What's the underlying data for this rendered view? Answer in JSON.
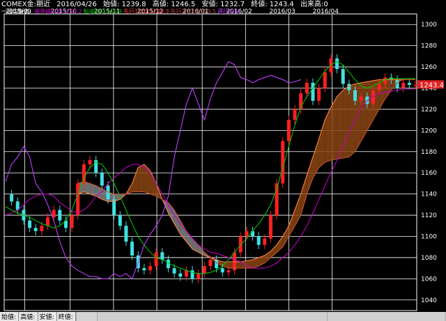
{
  "header": {
    "symbol": "COMEX金:期近",
    "date": "2016/04/26",
    "open": "始値: 1239.8",
    "high": "高値: 1246.5",
    "low": "安値: 1232.7",
    "close": "終値: 1243.4",
    "volume": "出来高:0"
  },
  "indicator_legend": {
    "title": "一目均衡表:",
    "items": [
      {
        "label": "基準線[26]1239.2",
        "color": "#c000c0"
      },
      {
        "label": "転換[9]1248.9",
        "color": "#00c000"
      },
      {
        "label": "先行1[26]1248.3",
        "color": "#ff4040"
      },
      {
        "label": "先行2[52]1173.5",
        "color": "#c04040"
      },
      {
        "label": "遅行[26]",
        "color": "#c040ff"
      }
    ]
  },
  "price_tag": "1243.4",
  "footer": {
    "labels": [
      "始値:",
      "高値:",
      "安値:",
      "終値:"
    ]
  },
  "colors": {
    "grid": "#ffffff",
    "up_candle": "#ff2020",
    "down_candle": "#40e0e0",
    "cloud": "#8b4513",
    "cloud_bear": "#808080",
    "kijun": "#c000c0",
    "tenkan": "#00c000",
    "senkou1": "#ff8040",
    "senkou2": "#c05030",
    "chikou": "#c040ff"
  },
  "chart_data": {
    "type": "line",
    "title": "COMEX金:期近",
    "x_tick_labels": [
      "2015/09",
      "2015/10",
      "2015/11",
      "2015/12",
      "2016/01",
      "2016/02",
      "2016/03",
      "2016/04"
    ],
    "y_tick_labels": [
      1040,
      1060,
      1080,
      1100,
      1120,
      1140,
      1160,
      1180,
      1200,
      1220,
      1240,
      1260,
      1280,
      1300
    ],
    "ylim": [
      1030,
      1310
    ],
    "grid": true,
    "last_price": 1243.4,
    "series": [
      {
        "name": "基準線[26]",
        "key": "kijun",
        "values": [
          1120,
          1122,
          1125,
          1130,
          1135,
          1138,
          1140,
          1140,
          1138,
          1132,
          1128,
          1124,
          1122,
          1125,
          1130,
          1138,
          1142,
          1150,
          1155,
          1160,
          1165,
          1168,
          1168,
          1165,
          1160,
          1150,
          1140,
          1130,
          1120,
          1112,
          1105,
          1098,
          1092,
          1088,
          1085,
          1084,
          1082,
          1080,
          1078,
          1076,
          1072,
          1070,
          1070,
          1070,
          1072,
          1075,
          1080,
          1085,
          1092,
          1100,
          1110,
          1122,
          1135,
          1148,
          1160,
          1172,
          1185,
          1198,
          1210,
          1222,
          1228,
          1232,
          1235,
          1236,
          1237,
          1238,
          1239,
          1239,
          1239
        ]
      },
      {
        "name": "転換[9]",
        "key": "tenkan",
        "values": [
          1128,
          1125,
          1122,
          1120,
          1118,
          1115,
          1112,
          1110,
          1108,
          1110,
          1115,
          1125,
          1140,
          1155,
          1165,
          1170,
          1168,
          1160,
          1150,
          1138,
          1125,
          1112,
          1100,
          1092,
          1085,
          1080,
          1078,
          1075,
          1072,
          1070,
          1068,
          1066,
          1065,
          1065,
          1066,
          1068,
          1072,
          1078,
          1085,
          1092,
          1098,
          1105,
          1112,
          1120,
          1130,
          1145,
          1165,
          1185,
          1205,
          1222,
          1232,
          1240,
          1248,
          1256,
          1262,
          1265,
          1262,
          1255,
          1248,
          1242,
          1240,
          1242,
          1245,
          1248,
          1249,
          1249,
          1249,
          1249,
          1249
        ]
      },
      {
        "name": "先行1[26]",
        "key": "senkou1",
        "values": [
          null,
          null,
          null,
          null,
          null,
          null,
          null,
          null,
          null,
          null,
          null,
          null,
          1140,
          1142,
          1140,
          1138,
          1135,
          1133,
          1133,
          1135,
          1140,
          1150,
          1165,
          1168,
          1162,
          1150,
          1135,
          1122,
          1112,
          1102,
          1095,
          1088,
          1085,
          1082,
          1080,
          1078,
          1076,
          1076,
          1076,
          1076,
          1077,
          1078,
          1080,
          1082,
          1086,
          1092,
          1100,
          1110,
          1125,
          1140,
          1158,
          1175,
          1192,
          1210,
          1222,
          1232,
          1238,
          1242,
          1244,
          1245,
          1246,
          1247,
          1248,
          1248,
          1248,
          1248,
          1248,
          1248,
          1248
        ]
      },
      {
        "name": "先行2[52]",
        "key": "senkou2",
        "values": [
          null,
          null,
          null,
          null,
          null,
          null,
          null,
          null,
          null,
          null,
          null,
          null,
          1150,
          1152,
          1150,
          1148,
          1145,
          1142,
          1140,
          1140,
          1140,
          1142,
          1142,
          1142,
          1140,
          1138,
          1135,
          1132,
          1125,
          1115,
          1105,
          1098,
          1092,
          1085,
          1080,
          1075,
          1072,
          1070,
          1070,
          1070,
          1070,
          1070,
          1072,
          1075,
          1080,
          1085,
          1090,
          1100,
          1110,
          1120,
          1140,
          1155,
          1165,
          1170,
          1172,
          1173,
          1174,
          1175,
          1180,
          1190,
          1200,
          1210,
          1220,
          1230,
          1238,
          1245,
          1248,
          1248,
          1248
        ]
      },
      {
        "name": "遅行[26]",
        "key": "chikou",
        "values": [
          1152,
          1168,
          1175,
          1185,
          1175,
          1150,
          1142,
          1130,
          1115,
          1095,
          1080,
          1072,
          1068,
          1065,
          1062,
          1062,
          1060,
          1060,
          1065,
          1062,
          1065,
          1060,
          1075,
          1092,
          1102,
          1110,
          1120,
          1138,
          1175,
          1200,
          1225,
          1240,
          1225,
          1210,
          1230,
          1245,
          1255,
          1265,
          1262,
          1250,
          1248,
          1245,
          1248,
          1250,
          1252,
          1250,
          1248,
          1245,
          1246,
          1248,
          null,
          null,
          null,
          null,
          null,
          null,
          null,
          null,
          null,
          null,
          null,
          null,
          null,
          null,
          null,
          null,
          null,
          null,
          null
        ]
      },
      {
        "name": "close",
        "key": "close",
        "values": [
          1140,
          1133,
          1125,
          1115,
          1108,
          1105,
          1110,
          1118,
          1125,
          1115,
          1108,
          1120,
          1150,
          1168,
          1172,
          1160,
          1148,
          1135,
          1120,
          1110,
          1095,
          1082,
          1070,
          1068,
          1072,
          1085,
          1078,
          1070,
          1065,
          1062,
          1068,
          1060,
          1065,
          1072,
          1078,
          1070,
          1066,
          1068,
          1085,
          1100,
          1105,
          1100,
          1092,
          1098,
          1120,
          1150,
          1190,
          1210,
          1220,
          1235,
          1245,
          1228,
          1240,
          1255,
          1268,
          1258,
          1244,
          1238,
          1228,
          1232,
          1225,
          1238,
          1244,
          1250,
          1248,
          1240,
          1245,
          1243,
          1243
        ]
      }
    ]
  }
}
